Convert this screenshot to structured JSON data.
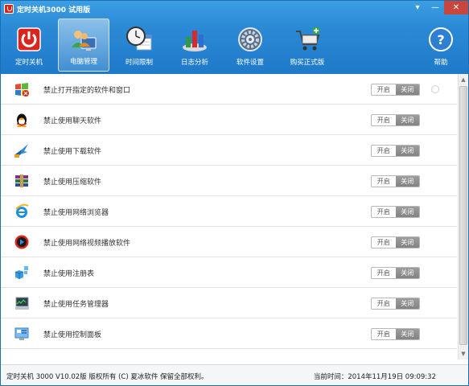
{
  "window": {
    "title": "定时关机3000 试用版",
    "controls": {
      "menu": "▾",
      "minimize": "—",
      "close": "✕"
    }
  },
  "toolbar": {
    "items": [
      {
        "label": "定时关机",
        "icon": "power-icon",
        "active": false
      },
      {
        "label": "电脑管理",
        "icon": "users-computer-icon",
        "active": true
      },
      {
        "label": "时间限制",
        "icon": "clock-calendar-icon",
        "active": false
      },
      {
        "label": "日志分析",
        "icon": "chart-icon",
        "active": false
      },
      {
        "label": "软件设置",
        "icon": "gear-icon",
        "active": false
      },
      {
        "label": "购买正式版",
        "icon": "cart-icon",
        "active": false
      },
      {
        "label": "帮助",
        "icon": "help-icon",
        "active": false
      }
    ]
  },
  "rules": [
    {
      "label": "禁止打开指定的软件和窗口",
      "icon": "windows-logo-icon",
      "on_label": "开启",
      "off_label": "关闭",
      "state": "off"
    },
    {
      "label": "禁止使用聊天软件",
      "icon": "qq-penguin-icon",
      "on_label": "开启",
      "off_label": "关闭",
      "state": "off"
    },
    {
      "label": "禁止使用下载软件",
      "icon": "download-bird-icon",
      "on_label": "开启",
      "off_label": "关闭",
      "state": "off"
    },
    {
      "label": "禁止使用压缩软件",
      "icon": "archive-books-icon",
      "on_label": "开启",
      "off_label": "关闭",
      "state": "off"
    },
    {
      "label": "禁止使用网络浏览器",
      "icon": "ie-browser-icon",
      "on_label": "开启",
      "off_label": "关闭",
      "state": "off"
    },
    {
      "label": "禁止使用网络视频播放软件",
      "icon": "video-player-icon",
      "on_label": "开启",
      "off_label": "关闭",
      "state": "off"
    },
    {
      "label": "禁止使用注册表",
      "icon": "registry-cubes-icon",
      "on_label": "开启",
      "off_label": "关闭",
      "state": "off"
    },
    {
      "label": "禁止使用任务管理器",
      "icon": "task-manager-icon",
      "on_label": "开启",
      "off_label": "关闭",
      "state": "off"
    },
    {
      "label": "禁止使用控制面板",
      "icon": "control-panel-icon",
      "on_label": "开启",
      "off_label": "关闭",
      "state": "off"
    }
  ],
  "status": {
    "left": "定时关机 3000 V10.02版  版权所有 (C)  夏冰软件 保留全部权利。",
    "right": "当前时间：2014年11月19日 09:09:32"
  },
  "colors": {
    "header_blue": "#2b8ad6",
    "toggle_off": "#8f8f8f"
  }
}
